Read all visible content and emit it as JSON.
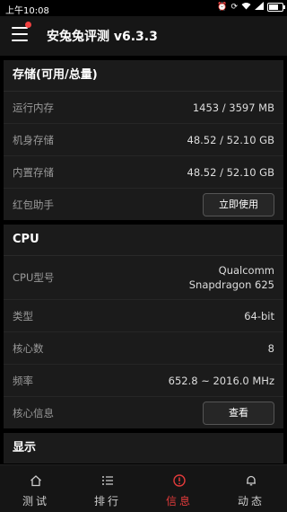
{
  "status_bar": {
    "time": "上午10:08",
    "battery_level": 0.7
  },
  "app_bar": {
    "title": "安兔兔评测 v6.3.3"
  },
  "storage": {
    "title": "存储(可用/总量)",
    "rows": [
      {
        "label": "运行内存",
        "value": "1453 / 3597 MB"
      },
      {
        "label": "机身存储",
        "value": "48.52 / 52.10 GB"
      },
      {
        "label": "内置存储",
        "value": "48.52 / 52.10 GB"
      }
    ],
    "redpacket_label": "红包助手",
    "redpacket_button": "立即使用"
  },
  "cpu": {
    "title": "CPU",
    "model_label": "CPU型号",
    "model_value_line1": "Qualcomm",
    "model_value_line2": "Snapdragon 625",
    "rows": [
      {
        "label": "类型",
        "value": "64-bit"
      },
      {
        "label": "核心数",
        "value": "8"
      },
      {
        "label": "频率",
        "value": "652.8 ~ 2016.0 MHz"
      }
    ],
    "core_info_label": "核心信息",
    "core_info_button": "查看"
  },
  "display": {
    "title": "显示"
  },
  "bottom_nav": [
    {
      "label": "测试",
      "icon": "home-icon"
    },
    {
      "label": "排行",
      "icon": "list-icon"
    },
    {
      "label": "信息",
      "icon": "info-icon",
      "active": true
    },
    {
      "label": "动态",
      "icon": "bell-icon"
    }
  ],
  "colors": {
    "accent": "#e23b3b",
    "card": "#1b1b1b",
    "background": "#000000"
  }
}
